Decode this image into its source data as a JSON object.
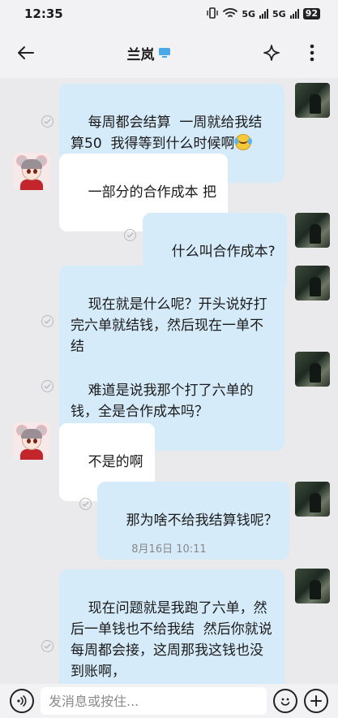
{
  "status_bar": {
    "time": "12:35",
    "net1": "5G",
    "net2": "5G",
    "battery": "92"
  },
  "header": {
    "title": "兰岚"
  },
  "messages": [
    {
      "text": "每周都会结算  一周就给我结算50  我得等到什么时候啊",
      "sender": "me",
      "emoji": "crying-laughing-emoji"
    },
    {
      "text": "一部分的合作成本 把",
      "sender": "other"
    },
    {
      "text": "什么叫合作成本?",
      "sender": "me"
    },
    {
      "text": "现在就是什么呢？开头说好打完六单就结钱，然后现在一单不结",
      "sender": "me"
    },
    {
      "text": "难道是说我那个打了六单的钱，全是合作成本吗？",
      "sender": "me"
    },
    {
      "text": "不是的啊",
      "sender": "other"
    },
    {
      "text": "那为啥不给我结算钱呢？",
      "sender": "me"
    },
    {
      "text": "现在问题就是我跑了六单，然后一单钱也不给我结  然后你就说每周都会接，这周那我这钱也没到账啊，",
      "sender": "me"
    }
  ],
  "timestamp": "8月16日  10:11",
  "input": {
    "placeholder": "发消息或按住..."
  },
  "colors": {
    "bubble_me": "#d6ebf9",
    "bubble_other": "#ffffff",
    "background": "#eaeaec"
  }
}
